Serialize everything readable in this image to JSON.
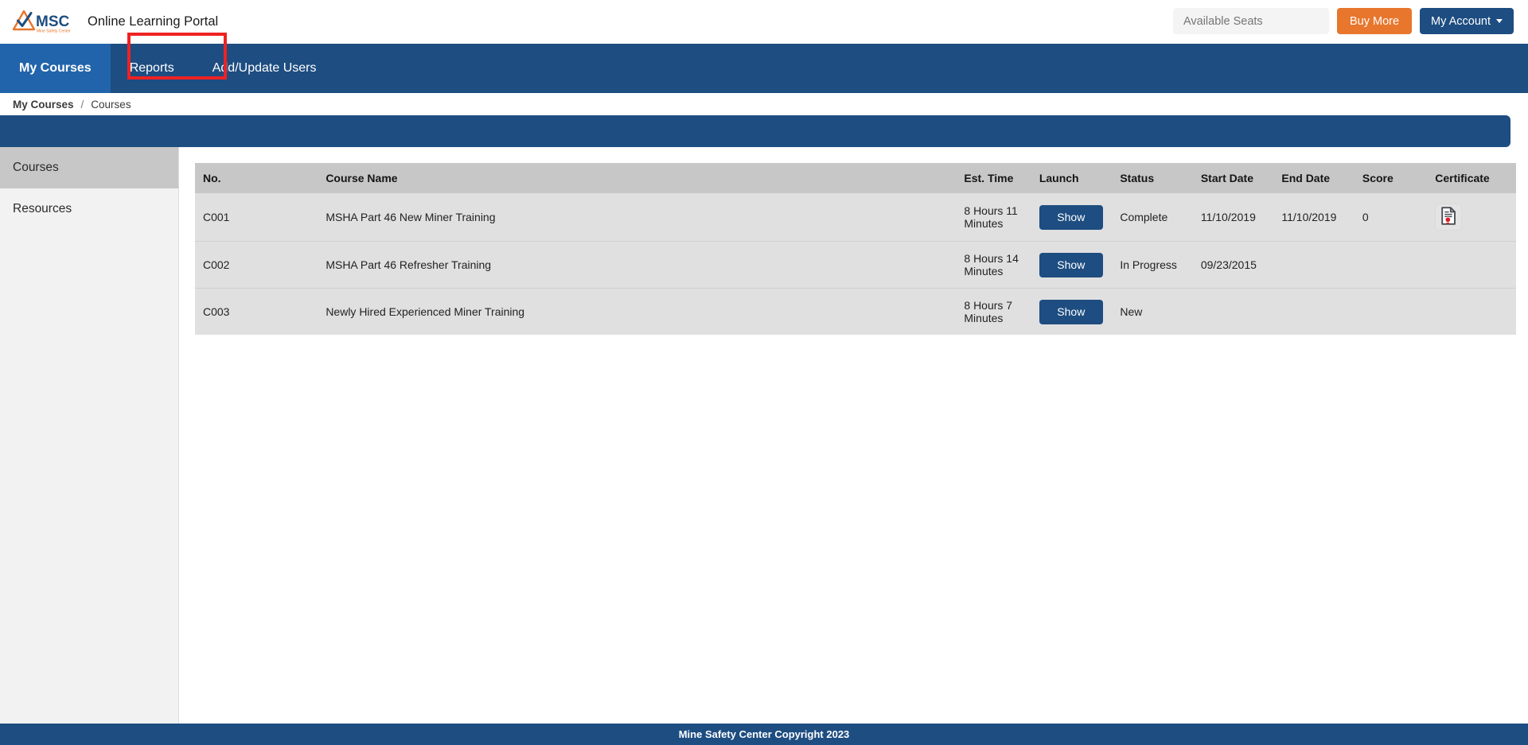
{
  "brand": {
    "logo_icon": "msc-triangle-check-logo",
    "logo_text": "MSC",
    "logo_subtext": "Mine Safety Center",
    "portal_title": "Online Learning Portal"
  },
  "topbar": {
    "seats_value": "",
    "seats_placeholder": "Available Seats",
    "buy_more_label": "Buy More",
    "my_account_label": "My Account"
  },
  "nav": {
    "items": [
      {
        "label": "My Courses",
        "active": true
      },
      {
        "label": "Reports",
        "active": false
      },
      {
        "label": "Add/Update Users",
        "active": false
      }
    ]
  },
  "breadcrumb": {
    "parent": "My Courses",
    "separator": "/",
    "current": "Courses"
  },
  "sidebar": {
    "items": [
      {
        "label": "Courses",
        "active": true
      },
      {
        "label": "Resources",
        "active": false
      }
    ]
  },
  "table": {
    "headers": {
      "no": "No.",
      "name": "Course Name",
      "time": "Est. Time",
      "launch": "Launch",
      "status": "Status",
      "start": "Start Date",
      "end": "End Date",
      "score": "Score",
      "certificate": "Certificate"
    },
    "launch_button_label": "Show",
    "certificate_icon": "certificate-document-seal-icon",
    "rows": [
      {
        "no": "C001",
        "name": "MSHA Part 46 New Miner Training",
        "time": "8 Hours 11 Minutes",
        "launch": "Show",
        "status": "Complete",
        "start_date": "11/10/2019",
        "end_date": "11/10/2019",
        "score": "0",
        "has_certificate": true
      },
      {
        "no": "C002",
        "name": "MSHA Part 46 Refresher Training",
        "time": "8 Hours 14 Minutes",
        "launch": "Show",
        "status": "In Progress",
        "start_date": "09/23/2015",
        "end_date": "",
        "score": "",
        "has_certificate": false
      },
      {
        "no": "C003",
        "name": "Newly Hired Experienced Miner Training",
        "time": "8 Hours 7 Minutes",
        "launch": "Show",
        "status": "New",
        "start_date": "",
        "end_date": "",
        "score": "",
        "has_certificate": false
      }
    ]
  },
  "footer": {
    "text": "Mine Safety Center Copyright 2023"
  },
  "annotation": {
    "target": "Add/Update Users",
    "color": "#ee2222"
  },
  "colors": {
    "brand_blue": "#1d4d81",
    "active_nav_blue": "#2164ab",
    "brand_orange": "#e8762c",
    "header_gray": "#c7c7c7",
    "row_gray": "#e0e0e0",
    "sidebar_gray": "#f2f2f2",
    "seal_red": "#d81f26"
  }
}
